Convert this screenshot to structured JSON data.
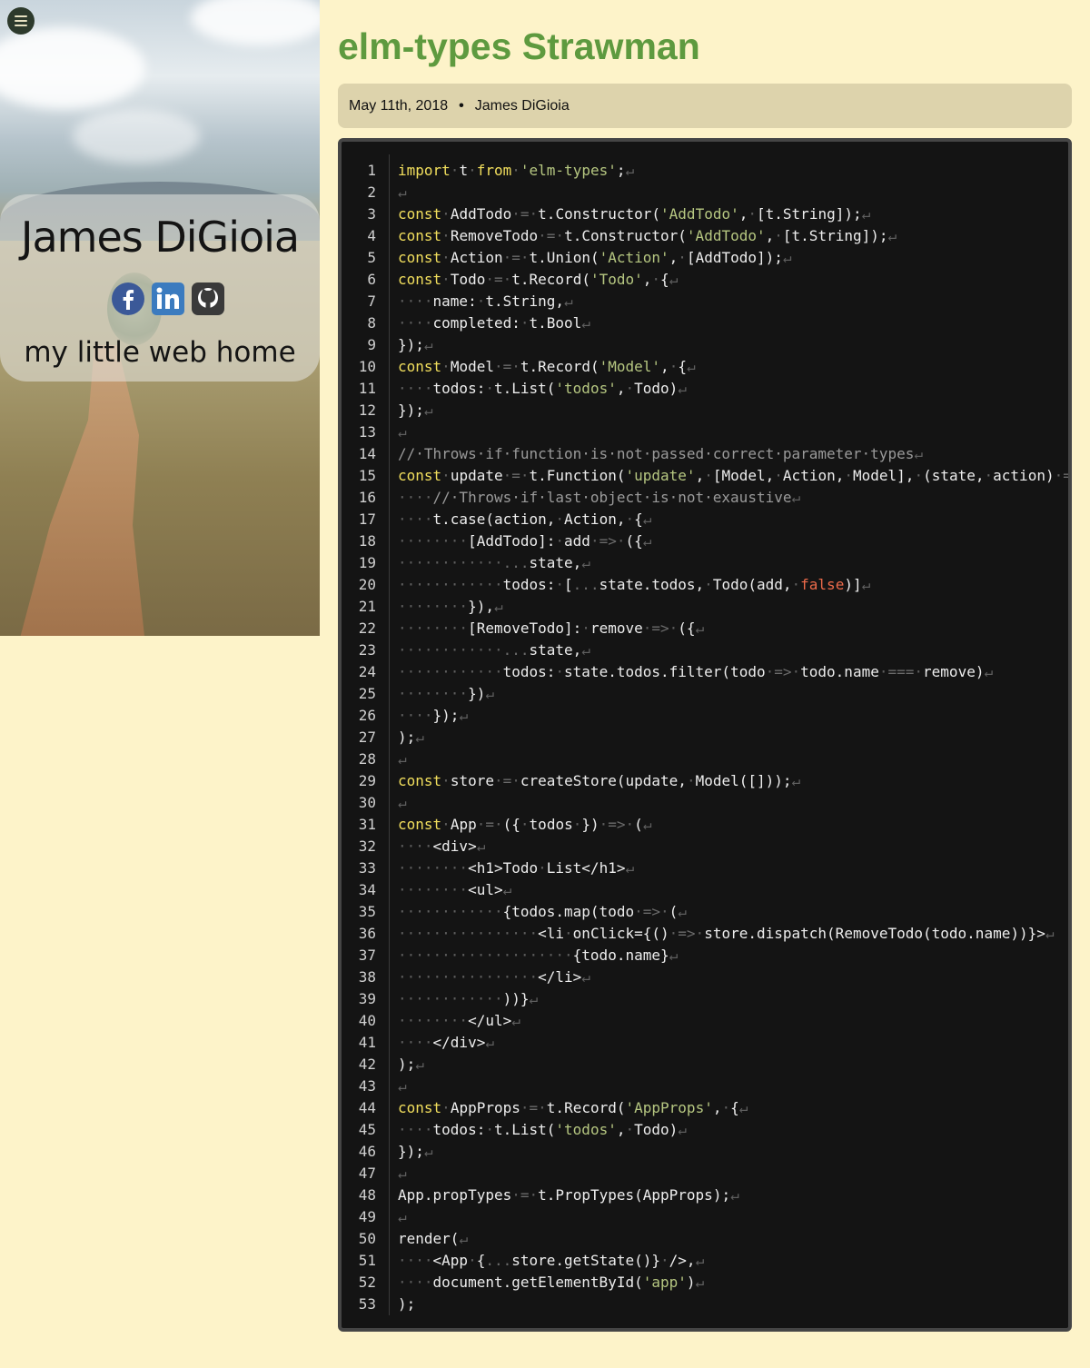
{
  "sidebar": {
    "menu_icon": "hamburger-menu-icon",
    "name": "James DiGioia",
    "tagline": "my little web home",
    "social_icons": [
      "facebook-icon",
      "linkedin-icon",
      "github-icon"
    ]
  },
  "post": {
    "title": "elm-types Strawman",
    "date": "May 11th, 2018",
    "separator": "•",
    "author": "James DiGioia"
  },
  "code": {
    "lines": [
      [
        [
          "kw",
          "import"
        ],
        [
          "ws",
          "·"
        ],
        [
          "",
          "t"
        ],
        [
          "ws",
          "·"
        ],
        [
          "kw",
          "from"
        ],
        [
          "ws",
          "·"
        ],
        [
          "str",
          "'elm-types'"
        ],
        [
          "",
          ";"
        ],
        [
          "ws",
          "↵"
        ]
      ],
      [
        [
          "ws",
          "↵"
        ]
      ],
      [
        [
          "kw",
          "const"
        ],
        [
          "ws",
          "·"
        ],
        [
          "",
          "AddTodo"
        ],
        [
          "ws",
          "·"
        ],
        [
          "op",
          "="
        ],
        [
          "ws",
          "·"
        ],
        [
          "",
          "t.Constructor("
        ],
        [
          "str",
          "'AddTodo'"
        ],
        [
          "",
          ","
        ],
        [
          "ws",
          "·"
        ],
        [
          "",
          "[t.String]);"
        ],
        [
          "ws",
          "↵"
        ]
      ],
      [
        [
          "kw",
          "const"
        ],
        [
          "ws",
          "·"
        ],
        [
          "",
          "RemoveTodo"
        ],
        [
          "ws",
          "·"
        ],
        [
          "op",
          "="
        ],
        [
          "ws",
          "·"
        ],
        [
          "",
          "t.Constructor("
        ],
        [
          "str",
          "'AddTodo'"
        ],
        [
          "",
          ","
        ],
        [
          "ws",
          "·"
        ],
        [
          "",
          "[t.String]);"
        ],
        [
          "ws",
          "↵"
        ]
      ],
      [
        [
          "kw",
          "const"
        ],
        [
          "ws",
          "·"
        ],
        [
          "",
          "Action"
        ],
        [
          "ws",
          "·"
        ],
        [
          "op",
          "="
        ],
        [
          "ws",
          "·"
        ],
        [
          "",
          "t.Union("
        ],
        [
          "str",
          "'Action'"
        ],
        [
          "",
          ","
        ],
        [
          "ws",
          "·"
        ],
        [
          "",
          "[AddTodo]);"
        ],
        [
          "ws",
          "↵"
        ]
      ],
      [
        [
          "kw",
          "const"
        ],
        [
          "ws",
          "·"
        ],
        [
          "",
          "Todo"
        ],
        [
          "ws",
          "·"
        ],
        [
          "op",
          "="
        ],
        [
          "ws",
          "·"
        ],
        [
          "",
          "t.Record("
        ],
        [
          "str",
          "'Todo'"
        ],
        [
          "",
          ","
        ],
        [
          "ws",
          "·"
        ],
        [
          "",
          "{"
        ],
        [
          "ws",
          "↵"
        ]
      ],
      [
        [
          "ws",
          "····"
        ],
        [
          "",
          "name:"
        ],
        [
          "ws",
          "·"
        ],
        [
          "",
          "t.String,"
        ],
        [
          "ws",
          "↵"
        ]
      ],
      [
        [
          "ws",
          "····"
        ],
        [
          "",
          "completed:"
        ],
        [
          "ws",
          "·"
        ],
        [
          "",
          "t.Bool"
        ],
        [
          "ws",
          "↵"
        ]
      ],
      [
        [
          "",
          "});"
        ],
        [
          "ws",
          "↵"
        ]
      ],
      [
        [
          "kw",
          "const"
        ],
        [
          "ws",
          "·"
        ],
        [
          "",
          "Model"
        ],
        [
          "ws",
          "·"
        ],
        [
          "op",
          "="
        ],
        [
          "ws",
          "·"
        ],
        [
          "",
          "t.Record("
        ],
        [
          "str",
          "'Model'"
        ],
        [
          "",
          ","
        ],
        [
          "ws",
          "·"
        ],
        [
          "",
          "{"
        ],
        [
          "ws",
          "↵"
        ]
      ],
      [
        [
          "ws",
          "····"
        ],
        [
          "",
          "todos:"
        ],
        [
          "ws",
          "·"
        ],
        [
          "",
          "t.List("
        ],
        [
          "str",
          "'todos'"
        ],
        [
          "",
          ","
        ],
        [
          "ws",
          "·"
        ],
        [
          "",
          "Todo)"
        ],
        [
          "ws",
          "↵"
        ]
      ],
      [
        [
          "",
          "});"
        ],
        [
          "ws",
          "↵"
        ]
      ],
      [
        [
          "ws",
          "↵"
        ]
      ],
      [
        [
          "cm",
          "//·Throws·if·function·is·not·passed·correct·parameter·types"
        ],
        [
          "ws",
          "↵"
        ]
      ],
      [
        [
          "kw",
          "const"
        ],
        [
          "ws",
          "·"
        ],
        [
          "",
          "update"
        ],
        [
          "ws",
          "·"
        ],
        [
          "op",
          "="
        ],
        [
          "ws",
          "·"
        ],
        [
          "",
          "t.Function("
        ],
        [
          "str",
          "'update'"
        ],
        [
          "",
          ","
        ],
        [
          "ws",
          "·"
        ],
        [
          "",
          "[Model,"
        ],
        [
          "ws",
          "·"
        ],
        [
          "",
          "Action,"
        ],
        [
          "ws",
          "·"
        ],
        [
          "",
          "Model],"
        ],
        [
          "ws",
          "·"
        ],
        [
          "",
          "(state,"
        ],
        [
          "ws",
          "·"
        ],
        [
          "",
          "action)"
        ],
        [
          "ws",
          "·"
        ],
        [
          "op",
          "=>"
        ]
      ],
      [
        [
          "ws",
          "····"
        ],
        [
          "cm",
          "//·Throws·if·last·object·is·not·exaustive"
        ],
        [
          "ws",
          "↵"
        ]
      ],
      [
        [
          "ws",
          "····"
        ],
        [
          "",
          "t.case(action,"
        ],
        [
          "ws",
          "·"
        ],
        [
          "",
          "Action,"
        ],
        [
          "ws",
          "·"
        ],
        [
          "",
          "{"
        ],
        [
          "ws",
          "↵"
        ]
      ],
      [
        [
          "ws",
          "········"
        ],
        [
          "",
          "[AddTodo]:"
        ],
        [
          "ws",
          "·"
        ],
        [
          "",
          "add"
        ],
        [
          "ws",
          "·"
        ],
        [
          "op",
          "=>"
        ],
        [
          "ws",
          "·"
        ],
        [
          "",
          "({"
        ],
        [
          "ws",
          "↵"
        ]
      ],
      [
        [
          "ws",
          "············"
        ],
        [
          "op",
          "..."
        ],
        [
          "",
          "state,"
        ],
        [
          "ws",
          "↵"
        ]
      ],
      [
        [
          "ws",
          "············"
        ],
        [
          "",
          "todos:"
        ],
        [
          "ws",
          "·"
        ],
        [
          "",
          "["
        ],
        [
          "op",
          "..."
        ],
        [
          "",
          "state.todos,"
        ],
        [
          "ws",
          "·"
        ],
        [
          "",
          "Todo(add,"
        ],
        [
          "ws",
          "·"
        ],
        [
          "bool",
          "false"
        ],
        [
          "",
          ")]"
        ],
        [
          "ws",
          "↵"
        ]
      ],
      [
        [
          "ws",
          "········"
        ],
        [
          "",
          "}),"
        ],
        [
          "ws",
          "↵"
        ]
      ],
      [
        [
          "ws",
          "········"
        ],
        [
          "",
          "[RemoveTodo]:"
        ],
        [
          "ws",
          "·"
        ],
        [
          "",
          "remove"
        ],
        [
          "ws",
          "·"
        ],
        [
          "op",
          "=>"
        ],
        [
          "ws",
          "·"
        ],
        [
          "",
          "({"
        ],
        [
          "ws",
          "↵"
        ]
      ],
      [
        [
          "ws",
          "············"
        ],
        [
          "op",
          "..."
        ],
        [
          "",
          "state,"
        ],
        [
          "ws",
          "↵"
        ]
      ],
      [
        [
          "ws",
          "············"
        ],
        [
          "",
          "todos:"
        ],
        [
          "ws",
          "·"
        ],
        [
          "",
          "state.todos.filter(todo"
        ],
        [
          "ws",
          "·"
        ],
        [
          "op",
          "=>"
        ],
        [
          "ws",
          "·"
        ],
        [
          "",
          "todo.name"
        ],
        [
          "ws",
          "·"
        ],
        [
          "op",
          "==="
        ],
        [
          "ws",
          "·"
        ],
        [
          "",
          "remove)"
        ],
        [
          "ws",
          "↵"
        ]
      ],
      [
        [
          "ws",
          "········"
        ],
        [
          "",
          "})"
        ],
        [
          "ws",
          "↵"
        ]
      ],
      [
        [
          "ws",
          "····"
        ],
        [
          "",
          "});"
        ],
        [
          "ws",
          "↵"
        ]
      ],
      [
        [
          "",
          ");"
        ],
        [
          "ws",
          "↵"
        ]
      ],
      [
        [
          "ws",
          "↵"
        ]
      ],
      [
        [
          "kw",
          "const"
        ],
        [
          "ws",
          "·"
        ],
        [
          "",
          "store"
        ],
        [
          "ws",
          "·"
        ],
        [
          "op",
          "="
        ],
        [
          "ws",
          "·"
        ],
        [
          "",
          "createStore(update,"
        ],
        [
          "ws",
          "·"
        ],
        [
          "",
          "Model([]));"
        ],
        [
          "ws",
          "↵"
        ]
      ],
      [
        [
          "ws",
          "↵"
        ]
      ],
      [
        [
          "kw",
          "const"
        ],
        [
          "ws",
          "·"
        ],
        [
          "",
          "App"
        ],
        [
          "ws",
          "·"
        ],
        [
          "op",
          "="
        ],
        [
          "ws",
          "·"
        ],
        [
          "",
          "({"
        ],
        [
          "ws",
          "·"
        ],
        [
          "",
          "todos"
        ],
        [
          "ws",
          "·"
        ],
        [
          "",
          "})"
        ],
        [
          "ws",
          "·"
        ],
        [
          "op",
          "=>"
        ],
        [
          "ws",
          "·"
        ],
        [
          "",
          "("
        ],
        [
          "ws",
          "↵"
        ]
      ],
      [
        [
          "ws",
          "····"
        ],
        [
          "",
          "<div>"
        ],
        [
          "ws",
          "↵"
        ]
      ],
      [
        [
          "ws",
          "········"
        ],
        [
          "",
          "<h1>Todo"
        ],
        [
          "ws",
          "·"
        ],
        [
          "",
          "List</h1>"
        ],
        [
          "ws",
          "↵"
        ]
      ],
      [
        [
          "ws",
          "········"
        ],
        [
          "",
          "<ul>"
        ],
        [
          "ws",
          "↵"
        ]
      ],
      [
        [
          "ws",
          "············"
        ],
        [
          "",
          "{todos.map(todo"
        ],
        [
          "ws",
          "·"
        ],
        [
          "op",
          "=>"
        ],
        [
          "ws",
          "·"
        ],
        [
          "",
          "("
        ],
        [
          "ws",
          "↵"
        ]
      ],
      [
        [
          "ws",
          "················"
        ],
        [
          "",
          "<li"
        ],
        [
          "ws",
          "·"
        ],
        [
          "",
          "onClick={()"
        ],
        [
          "ws",
          "·"
        ],
        [
          "op",
          "=>"
        ],
        [
          "ws",
          "·"
        ],
        [
          "",
          "store.dispatch(RemoveTodo(todo.name))}>"
        ],
        [
          "ws",
          "↵"
        ]
      ],
      [
        [
          "ws",
          "····················"
        ],
        [
          "",
          "{todo.name}"
        ],
        [
          "ws",
          "↵"
        ]
      ],
      [
        [
          "ws",
          "················"
        ],
        [
          "",
          "</li>"
        ],
        [
          "ws",
          "↵"
        ]
      ],
      [
        [
          "ws",
          "············"
        ],
        [
          "",
          "))}"
        ],
        [
          "ws",
          "↵"
        ]
      ],
      [
        [
          "ws",
          "········"
        ],
        [
          "",
          "</ul>"
        ],
        [
          "ws",
          "↵"
        ]
      ],
      [
        [
          "ws",
          "····"
        ],
        [
          "",
          "</div>"
        ],
        [
          "ws",
          "↵"
        ]
      ],
      [
        [
          "",
          ");"
        ],
        [
          "ws",
          "↵"
        ]
      ],
      [
        [
          "ws",
          "↵"
        ]
      ],
      [
        [
          "kw",
          "const"
        ],
        [
          "ws",
          "·"
        ],
        [
          "",
          "AppProps"
        ],
        [
          "ws",
          "·"
        ],
        [
          "op",
          "="
        ],
        [
          "ws",
          "·"
        ],
        [
          "",
          "t.Record("
        ],
        [
          "str",
          "'AppProps'"
        ],
        [
          "",
          ","
        ],
        [
          "ws",
          "·"
        ],
        [
          "",
          "{"
        ],
        [
          "ws",
          "↵"
        ]
      ],
      [
        [
          "ws",
          "····"
        ],
        [
          "",
          "todos:"
        ],
        [
          "ws",
          "·"
        ],
        [
          "",
          "t.List("
        ],
        [
          "str",
          "'todos'"
        ],
        [
          "",
          ","
        ],
        [
          "ws",
          "·"
        ],
        [
          "",
          "Todo)"
        ],
        [
          "ws",
          "↵"
        ]
      ],
      [
        [
          "",
          "});"
        ],
        [
          "ws",
          "↵"
        ]
      ],
      [
        [
          "ws",
          "↵"
        ]
      ],
      [
        [
          "",
          "App.propTypes"
        ],
        [
          "ws",
          "·"
        ],
        [
          "op",
          "="
        ],
        [
          "ws",
          "·"
        ],
        [
          "",
          "t.PropTypes(AppProps);"
        ],
        [
          "ws",
          "↵"
        ]
      ],
      [
        [
          "ws",
          "↵"
        ]
      ],
      [
        [
          "",
          "render("
        ],
        [
          "ws",
          "↵"
        ]
      ],
      [
        [
          "ws",
          "····"
        ],
        [
          "",
          "<App"
        ],
        [
          "ws",
          "·"
        ],
        [
          "",
          "{"
        ],
        [
          "op",
          "..."
        ],
        [
          "",
          "store.getState()}"
        ],
        [
          "ws",
          "·"
        ],
        [
          "",
          "/>,"
        ],
        [
          "ws",
          "↵"
        ]
      ],
      [
        [
          "ws",
          "····"
        ],
        [
          "",
          "document.getElementById("
        ],
        [
          "str",
          "'app'"
        ],
        [
          "",
          ")"
        ],
        [
          "ws",
          "↵"
        ]
      ],
      [
        [
          "",
          ");"
        ]
      ]
    ]
  }
}
